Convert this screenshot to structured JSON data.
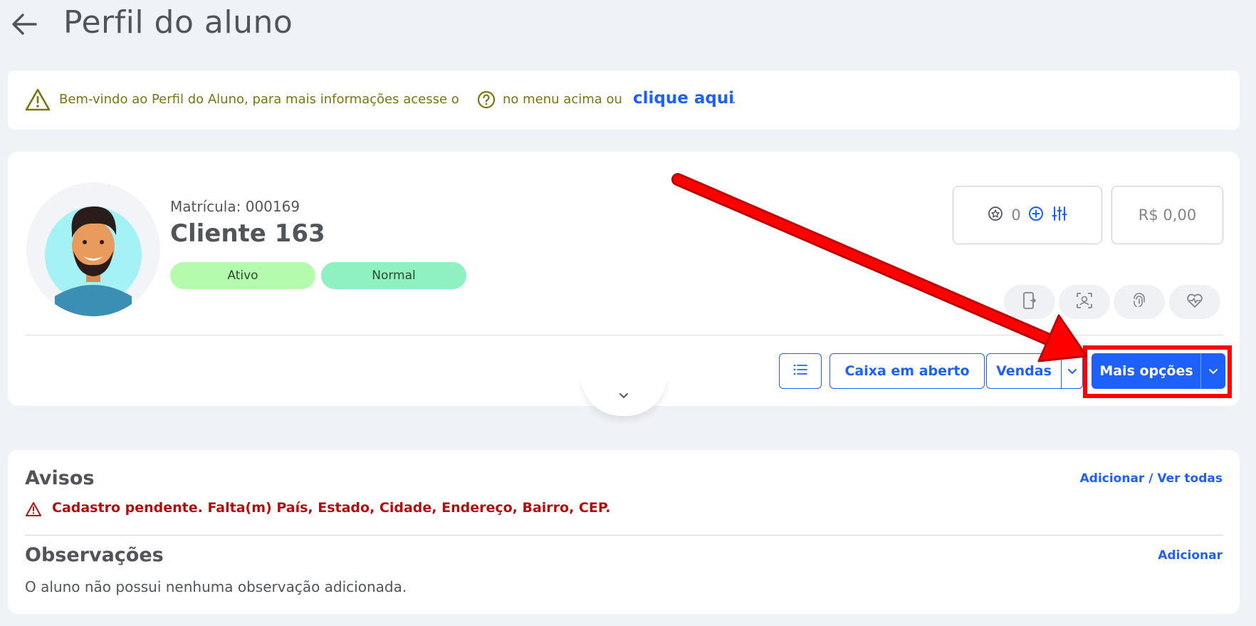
{
  "header": {
    "title": "Perfil do aluno"
  },
  "banner": {
    "text_before": "Bem-vindo ao Perfil do Aluno, para mais informações acesse o",
    "text_after": "no menu acima ou",
    "link": "clique aqui",
    "end": "."
  },
  "profile": {
    "matricula": "Matrícula: 000169",
    "name": "Cliente 163",
    "tags": [
      "Ativo",
      "Normal"
    ],
    "points": "0",
    "balance": "R$ 0,00"
  },
  "actions": {
    "caixa": "Caixa em aberto",
    "vendas": "Vendas",
    "mais": "Mais opções"
  },
  "avisos": {
    "title": "Avisos",
    "link": "Adicionar / Ver todas",
    "warning": "Cadastro pendente. Falta(m) País, Estado, Cidade, Endereço, Bairro, CEP."
  },
  "observacoes": {
    "title": "Observações",
    "link": "Adicionar",
    "empty": "O aluno não possui nenhuma observação adicionada."
  },
  "colors": {
    "accent": "#1e60fa",
    "warning_text": "#7d7410",
    "error_text": "#b00f0f",
    "tag_ativo": "#b4fbae",
    "tag_normal": "#8ff0c2",
    "annotation": "#ff0000"
  }
}
